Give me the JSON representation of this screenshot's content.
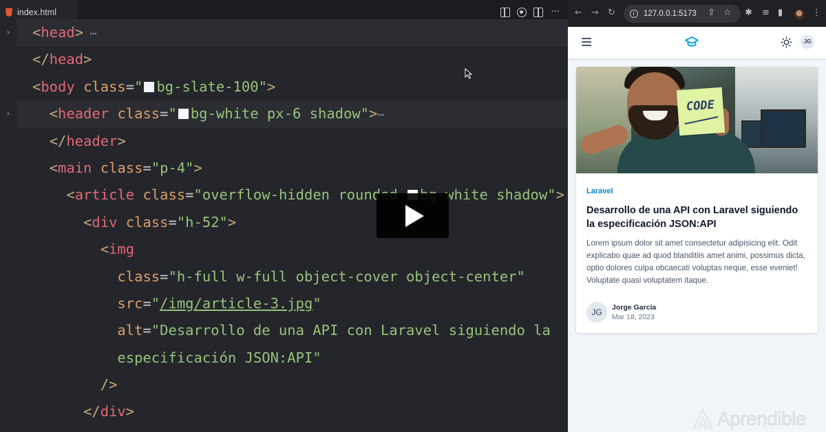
{
  "editor": {
    "tab_label": "index.html",
    "more_label": "···",
    "fold_glyph": "›",
    "ellipsis": "⋯",
    "lines": [
      {
        "hl": true,
        "fold": true,
        "parts": [
          [
            "br",
            "<"
          ],
          [
            "tag",
            "head"
          ],
          [
            "br",
            ">"
          ],
          [
            "dots",
            " ⋯"
          ]
        ]
      },
      {
        "hl": false,
        "fold": false,
        "parts": [
          [
            "br",
            "</"
          ],
          [
            "tag",
            "head"
          ],
          [
            "br",
            ">"
          ]
        ]
      },
      {
        "hl": false,
        "fold": false,
        "parts": [
          [
            "br",
            "<"
          ],
          [
            "tag",
            "body"
          ],
          [
            "sp",
            " "
          ],
          [
            "attr",
            "class"
          ],
          [
            "eq",
            "="
          ],
          [
            "str",
            "\""
          ],
          [
            "swatch",
            "slate"
          ],
          [
            "str",
            "bg-slate-100\""
          ],
          [
            "br",
            ">"
          ]
        ]
      },
      {
        "hl": true,
        "fold": true,
        "parts": [
          [
            "sp",
            "  "
          ],
          [
            "br",
            "<"
          ],
          [
            "tag",
            "header"
          ],
          [
            "sp",
            " "
          ],
          [
            "attr",
            "class"
          ],
          [
            "eq",
            "="
          ],
          [
            "str",
            "\""
          ],
          [
            "swatch",
            "white"
          ],
          [
            "str",
            "bg-white px-6 shadow\""
          ],
          [
            "br",
            ">"
          ],
          [
            "dots",
            "⋯"
          ]
        ]
      },
      {
        "hl": false,
        "fold": false,
        "parts": [
          [
            "sp",
            "  "
          ],
          [
            "br",
            "</"
          ],
          [
            "tag",
            "header"
          ],
          [
            "br",
            ">"
          ]
        ]
      },
      {
        "hl": false,
        "fold": false,
        "parts": [
          [
            "sp",
            "  "
          ],
          [
            "br",
            "<"
          ],
          [
            "tag",
            "main"
          ],
          [
            "sp",
            " "
          ],
          [
            "attr",
            "class"
          ],
          [
            "eq",
            "="
          ],
          [
            "str",
            "\"p-4\""
          ],
          [
            "br",
            ">"
          ]
        ]
      },
      {
        "hl": false,
        "fold": false,
        "parts": [
          [
            "sp",
            "    "
          ],
          [
            "br",
            "<"
          ],
          [
            "tag",
            "article"
          ],
          [
            "sp",
            " "
          ],
          [
            "attr",
            "class"
          ],
          [
            "eq",
            "="
          ],
          [
            "str",
            "\"overflow-hidden rounded "
          ],
          [
            "swatch",
            "white"
          ],
          [
            "str",
            "bg-white shadow\""
          ],
          [
            "br",
            ">"
          ]
        ]
      },
      {
        "hl": false,
        "fold": false,
        "parts": [
          [
            "sp",
            "      "
          ],
          [
            "br",
            "<"
          ],
          [
            "tag",
            "div"
          ],
          [
            "sp",
            " "
          ],
          [
            "attr",
            "class"
          ],
          [
            "eq",
            "="
          ],
          [
            "str",
            "\"h-52\""
          ],
          [
            "br",
            ">"
          ]
        ]
      },
      {
        "hl": false,
        "fold": false,
        "parts": [
          [
            "sp",
            "        "
          ],
          [
            "br",
            "<"
          ],
          [
            "tag",
            "img"
          ]
        ]
      },
      {
        "hl": false,
        "fold": false,
        "parts": [
          [
            "sp",
            "          "
          ],
          [
            "attr",
            "class"
          ],
          [
            "eq",
            "="
          ],
          [
            "str",
            "\"h-full w-full object-cover object-center\""
          ]
        ]
      },
      {
        "hl": false,
        "fold": false,
        "parts": [
          [
            "sp",
            "          "
          ],
          [
            "attr",
            "src"
          ],
          [
            "eq",
            "="
          ],
          [
            "str",
            "\""
          ],
          [
            "link",
            "/img/article-3.jpg"
          ],
          [
            "str",
            "\""
          ]
        ]
      },
      {
        "hl": false,
        "fold": false,
        "parts": [
          [
            "sp",
            "          "
          ],
          [
            "attr",
            "alt"
          ],
          [
            "eq",
            "="
          ],
          [
            "str",
            "\"Desarrollo de una API con Laravel siguiendo la"
          ]
        ]
      },
      {
        "hl": false,
        "fold": false,
        "parts": [
          [
            "sp",
            "          "
          ],
          [
            "str",
            "especificación JSON:API\""
          ]
        ]
      },
      {
        "hl": false,
        "fold": false,
        "parts": [
          [
            "sp",
            "        "
          ],
          [
            "br",
            "/>"
          ]
        ]
      },
      {
        "hl": false,
        "fold": false,
        "parts": [
          [
            "sp",
            "      "
          ],
          [
            "br",
            "</"
          ],
          [
            "tag",
            "div"
          ],
          [
            "br",
            ">"
          ]
        ]
      }
    ]
  },
  "video": {
    "play_label": "Play"
  },
  "browser": {
    "url": "127.0.0.1:5173",
    "nav": {
      "back": "←",
      "forward": "→",
      "reload": "↻"
    },
    "toolbar_icons": {
      "share": "⇧",
      "star": "☆",
      "extensions": "✱",
      "playlist": "≡",
      "sidepanel": "▮",
      "menu": "⋮"
    },
    "app": {
      "avatar_initials": "JG",
      "accent": "#0ea5e9"
    },
    "article": {
      "image_sticky_text": "CODE",
      "category": "Laravel",
      "title": "Desarrollo de una API con Laravel siguiendo la especificación JSON:API",
      "excerpt": "Lorem ipsum dolor sit amet consectetur adipisicing elit. Odit explicabo quae ad quod blanditiis amet animi, possimus dicta, optio dolores culpa obcaecati voluptas neque, esse eveniet! Voluptate quasi voluptatem itaque.",
      "author": {
        "initials": "JG",
        "name": "Jorge García",
        "date": "Mar 18, 2023"
      }
    }
  },
  "watermark": {
    "text": "Aprendible"
  }
}
